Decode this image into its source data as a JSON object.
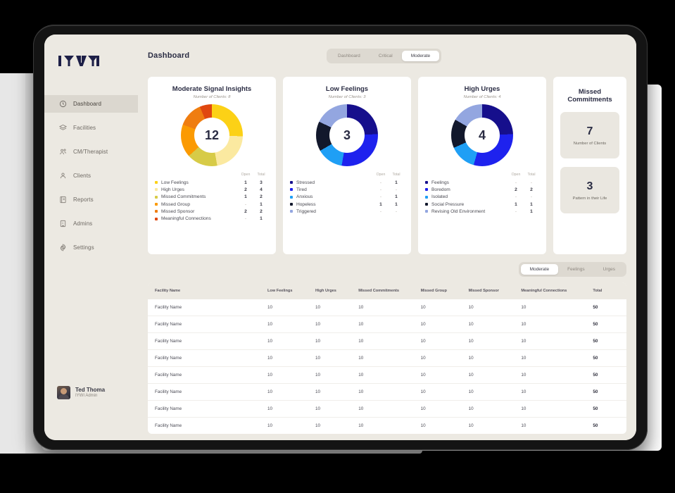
{
  "brand": {
    "name": "IYWI"
  },
  "sidebar": {
    "items": [
      {
        "label": "Dashboard",
        "icon": "clock-icon",
        "active": true
      },
      {
        "label": "Facilities",
        "icon": "layers-icon",
        "active": false
      },
      {
        "label": "CM/Therapist",
        "icon": "users-icon",
        "active": false
      },
      {
        "label": "Clients",
        "icon": "user-icon",
        "active": false
      },
      {
        "label": "Reports",
        "icon": "report-icon",
        "active": false
      },
      {
        "label": "Admins",
        "icon": "building-icon",
        "active": false
      },
      {
        "label": "Settings",
        "icon": "gear-icon",
        "active": false
      }
    ],
    "profile": {
      "name": "Ted Thoma",
      "role": "IYWI Admin"
    }
  },
  "header": {
    "title": "Dashboard",
    "tabs": [
      {
        "label": "Dashboard",
        "active": false
      },
      {
        "label": "Critical",
        "active": false
      },
      {
        "label": "Moderate",
        "active": true
      }
    ]
  },
  "cards": [
    {
      "title": "Moderate Signal Insights",
      "subtitle": "Number of Clients: 8",
      "center_value": "12",
      "legend_headers": {
        "open": "Open",
        "total": "Total"
      },
      "legend": [
        {
          "label": "Low Feelings",
          "color": "#fcd116",
          "open": "1",
          "total": "3"
        },
        {
          "label": "High Urges",
          "color": "#fbe9a0",
          "open": "2",
          "total": "4"
        },
        {
          "label": "Missed Commitments",
          "color": "#d7cb47",
          "open": "1",
          "total": "2"
        },
        {
          "label": "Missed Group",
          "color": "#fb9a02",
          "open": "-",
          "total": "1"
        },
        {
          "label": "Missed Sponsor",
          "color": "#ef7d10",
          "open": "2",
          "total": "2"
        },
        {
          "label": "Meaningful Connections",
          "color": "#e0470f",
          "open": "-",
          "total": "1"
        }
      ]
    },
    {
      "title": "Low Feelings",
      "subtitle": "Number of Clients: 3",
      "center_value": "3",
      "legend_headers": {
        "open": "Open",
        "total": "Total"
      },
      "legend": [
        {
          "label": "Stressed",
          "color": "#160f8c",
          "open": "-",
          "total": "1"
        },
        {
          "label": "Tired",
          "color": "#1e22ee",
          "open": "-",
          "total": "-"
        },
        {
          "label": "Anxious",
          "color": "#1f9ff5",
          "open": "-",
          "total": "1"
        },
        {
          "label": "Hopeless",
          "color": "#12182c",
          "open": "1",
          "total": "1"
        },
        {
          "label": "Triggered",
          "color": "#93a6e0",
          "open": "-",
          "total": "-"
        }
      ]
    },
    {
      "title": "High Urges",
      "subtitle": "Number of Clients: 4",
      "center_value": "4",
      "legend_headers": {
        "open": "Open",
        "total": "Total"
      },
      "legend": [
        {
          "label": "Feelings",
          "color": "#160f8c",
          "open": "-",
          "total": "-"
        },
        {
          "label": "Boredom",
          "color": "#1e22ee",
          "open": "2",
          "total": "2"
        },
        {
          "label": "Isolated",
          "color": "#1f9ff5",
          "open": "-",
          "total": "-"
        },
        {
          "label": "Social Pressure",
          "color": "#12182c",
          "open": "1",
          "total": "1"
        },
        {
          "label": "Revising Old Environment",
          "color": "#93a6e0",
          "open": "-",
          "total": "1"
        }
      ]
    }
  ],
  "missed_commitments": {
    "title_line1": "Missed",
    "title_line2": "Commitments",
    "stats": [
      {
        "value": "7",
        "label": "Number of Clients"
      },
      {
        "value": "3",
        "label": "Pattern in their Life"
      }
    ]
  },
  "table_tabs": [
    {
      "label": "Moderate",
      "active": true
    },
    {
      "label": "Feelings",
      "active": false
    },
    {
      "label": "Urges",
      "active": false
    }
  ],
  "table": {
    "columns": [
      "Facility Name",
      "Low Feelings",
      "High Urges",
      "Missed Commitments",
      "Missed Group",
      "Missed Sponsor",
      "Meaningful Connections",
      "Total"
    ],
    "rows": [
      [
        "Facility Name",
        "10",
        "10",
        "10",
        "10",
        "10",
        "10",
        "50"
      ],
      [
        "Facility Name",
        "10",
        "10",
        "10",
        "10",
        "10",
        "10",
        "50"
      ],
      [
        "Facility Name",
        "10",
        "10",
        "10",
        "10",
        "10",
        "10",
        "50"
      ],
      [
        "Facility Name",
        "10",
        "10",
        "10",
        "10",
        "10",
        "10",
        "50"
      ],
      [
        "Facility Name",
        "10",
        "10",
        "10",
        "10",
        "10",
        "10",
        "50"
      ],
      [
        "Facility Name",
        "10",
        "10",
        "10",
        "10",
        "10",
        "10",
        "50"
      ],
      [
        "Facility Name",
        "10",
        "10",
        "10",
        "10",
        "10",
        "10",
        "50"
      ],
      [
        "Facility Name",
        "10",
        "10",
        "10",
        "10",
        "10",
        "10",
        "50"
      ]
    ]
  },
  "chart_data": [
    {
      "type": "pie",
      "title": "Moderate Signal Insights",
      "subtitle": "Number of Clients: 8",
      "center_label": "12",
      "categories": [
        "Low Feelings",
        "High Urges",
        "Missed Commitments",
        "Missed Group",
        "Missed Sponsor",
        "Meaningful Connections"
      ],
      "values": [
        3,
        4,
        2,
        1,
        2,
        1
      ],
      "open_values": [
        1,
        2,
        1,
        0,
        2,
        0
      ],
      "colors": [
        "#fcd116",
        "#fbe9a0",
        "#d7cb47",
        "#fb9a02",
        "#ef7d10",
        "#e0470f"
      ],
      "legend_position": "below",
      "total": 13
    },
    {
      "type": "pie",
      "title": "Low Feelings",
      "subtitle": "Number of Clients: 3",
      "center_label": "3",
      "categories": [
        "Stressed",
        "Tired",
        "Anxious",
        "Hopeless",
        "Triggered"
      ],
      "values": [
        1,
        1,
        1,
        1,
        1
      ],
      "open_values": [
        0,
        0,
        0,
        1,
        0
      ],
      "colors": [
        "#160f8c",
        "#1e22ee",
        "#1f9ff5",
        "#12182c",
        "#93a6e0"
      ],
      "legend_position": "below",
      "total": 5
    },
    {
      "type": "pie",
      "title": "High Urges",
      "subtitle": "Number of Clients: 4",
      "center_label": "4",
      "categories": [
        "Feelings",
        "Boredom",
        "Isolated",
        "Social Pressure",
        "Revising Old Environment"
      ],
      "values": [
        1,
        1,
        1,
        1,
        1
      ],
      "open_values": [
        0,
        2,
        0,
        1,
        0
      ],
      "colors": [
        "#160f8c",
        "#1e22ee",
        "#1f9ff5",
        "#12182c",
        "#93a6e0"
      ],
      "legend_position": "below",
      "total": 5
    }
  ],
  "donut_geometry": [
    {
      "stops": [
        [
          "#fcd116",
          0,
          92
        ],
        [
          "#fbe9a0",
          92,
          170
        ],
        [
          "#d7cb47",
          170,
          228
        ],
        [
          "#fb9a02",
          228,
          290
        ],
        [
          "#ef7d10",
          290,
          337
        ],
        [
          "#e0470f",
          337,
          360
        ]
      ]
    },
    {
      "stops": [
        [
          "#160f8c",
          0,
          88
        ],
        [
          "#1e22ee",
          88,
          190
        ],
        [
          "#1f9ff5",
          190,
          240
        ],
        [
          "#12182c",
          240,
          296
        ],
        [
          "#93a6e0",
          296,
          360
        ]
      ]
    },
    {
      "stops": [
        [
          "#160f8c",
          0,
          88
        ],
        [
          "#1e22ee",
          88,
          196
        ],
        [
          "#1f9ff5",
          196,
          246
        ],
        [
          "#12182c",
          246,
          300
        ],
        [
          "#93a6e0",
          300,
          360
        ]
      ]
    }
  ]
}
